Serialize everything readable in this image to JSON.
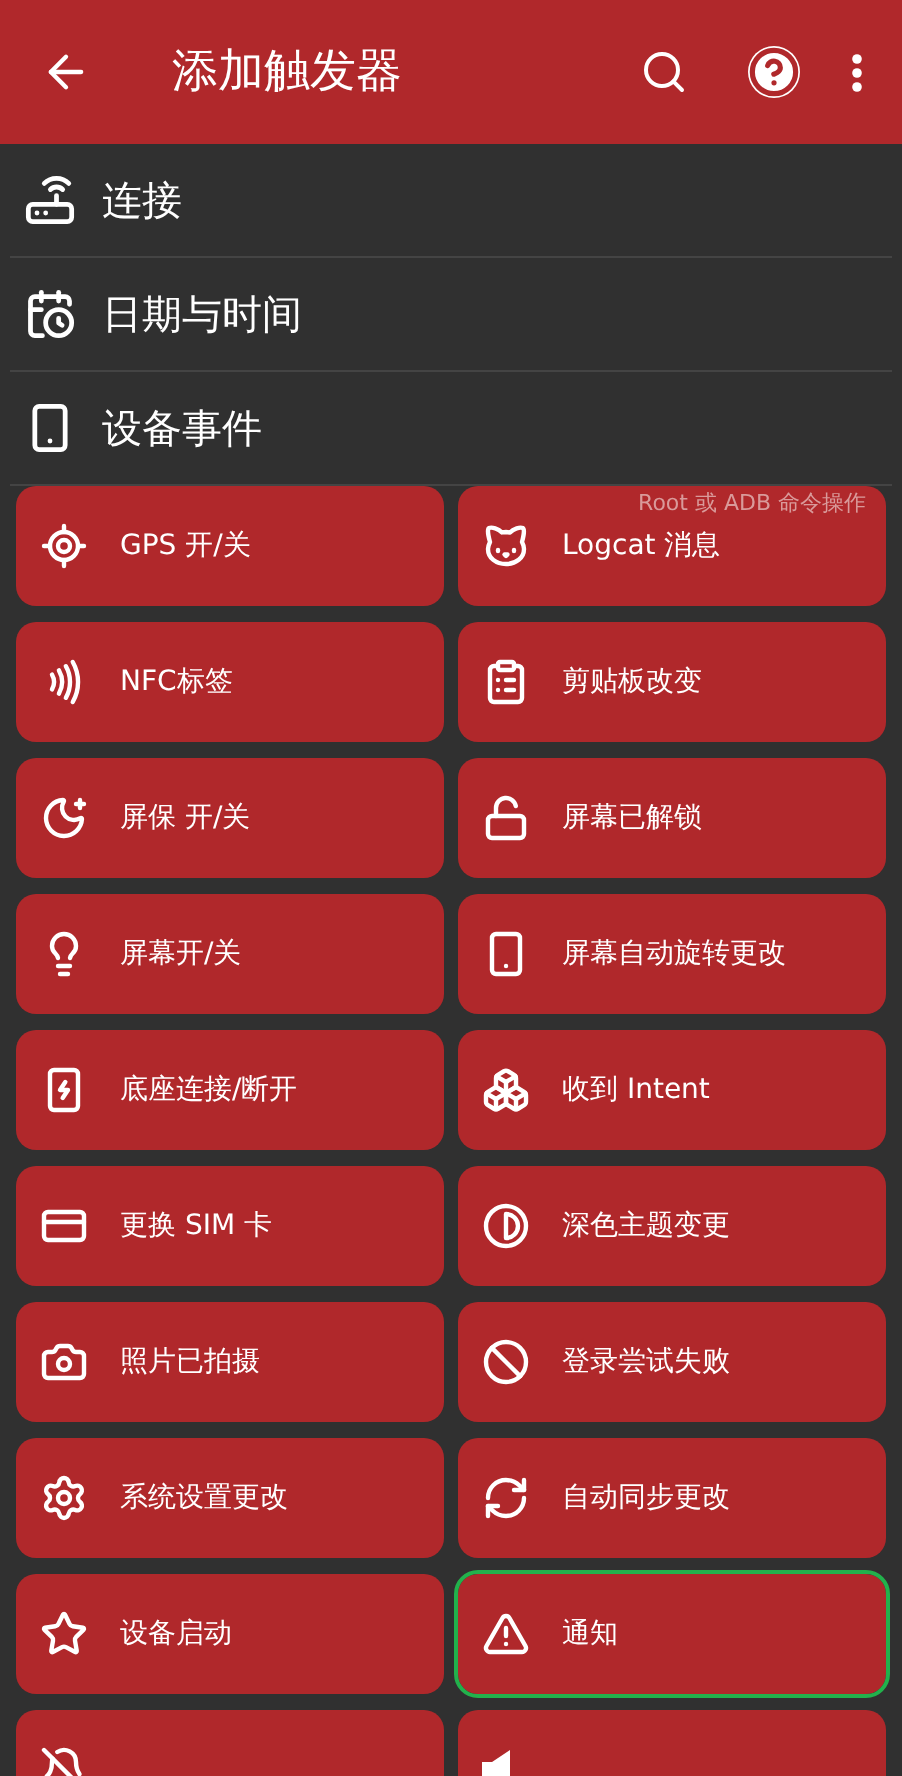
{
  "toolbar": {
    "title": "添加触发器"
  },
  "categories": [
    {
      "label": "连接",
      "kind": "router"
    },
    {
      "label": "日期与时间",
      "kind": "calendar"
    },
    {
      "label": "设备事件",
      "kind": "phone"
    }
  ],
  "triggers": [
    {
      "label": "GPS 开/关",
      "kind": "gps",
      "highlighted": false
    },
    {
      "label": "Logcat 消息",
      "kind": "cat",
      "highlighted": false
    },
    {
      "label": "NFC标签",
      "kind": "nfc",
      "highlighted": false
    },
    {
      "label": "剪贴板改变",
      "kind": "clipboard",
      "highlighted": false
    },
    {
      "label": "屏保 开/关",
      "kind": "moon",
      "highlighted": false
    },
    {
      "label": "屏幕已解锁",
      "kind": "unlock",
      "highlighted": false
    },
    {
      "label": "屏幕开/关",
      "kind": "bulb",
      "highlighted": false
    },
    {
      "label": "屏幕自动旋转更改",
      "kind": "rotate",
      "highlighted": false
    },
    {
      "label": "底座连接/断开",
      "kind": "dock",
      "highlighted": false
    },
    {
      "label": "收到 Intent",
      "kind": "intent",
      "highlighted": false
    },
    {
      "label": "更换 SIM 卡",
      "kind": "sim",
      "highlighted": false
    },
    {
      "label": "深色主题变更",
      "kind": "contrast",
      "highlighted": false
    },
    {
      "label": "照片已拍摄",
      "kind": "camera",
      "highlighted": false
    },
    {
      "label": "登录尝试失败",
      "kind": "ban",
      "highlighted": false
    },
    {
      "label": "系统设置更改",
      "kind": "settings",
      "highlighted": false
    },
    {
      "label": "自动同步更改",
      "kind": "sync",
      "highlighted": false
    },
    {
      "label": "设备启动",
      "kind": "star",
      "highlighted": false
    },
    {
      "label": "通知",
      "kind": "warning",
      "highlighted": true
    },
    {
      "kind": "mute",
      "highlighted": false
    },
    {
      "kind": "volume",
      "highlighted": false
    }
  ],
  "grid_note": "Root 或 ADB 命令操作"
}
